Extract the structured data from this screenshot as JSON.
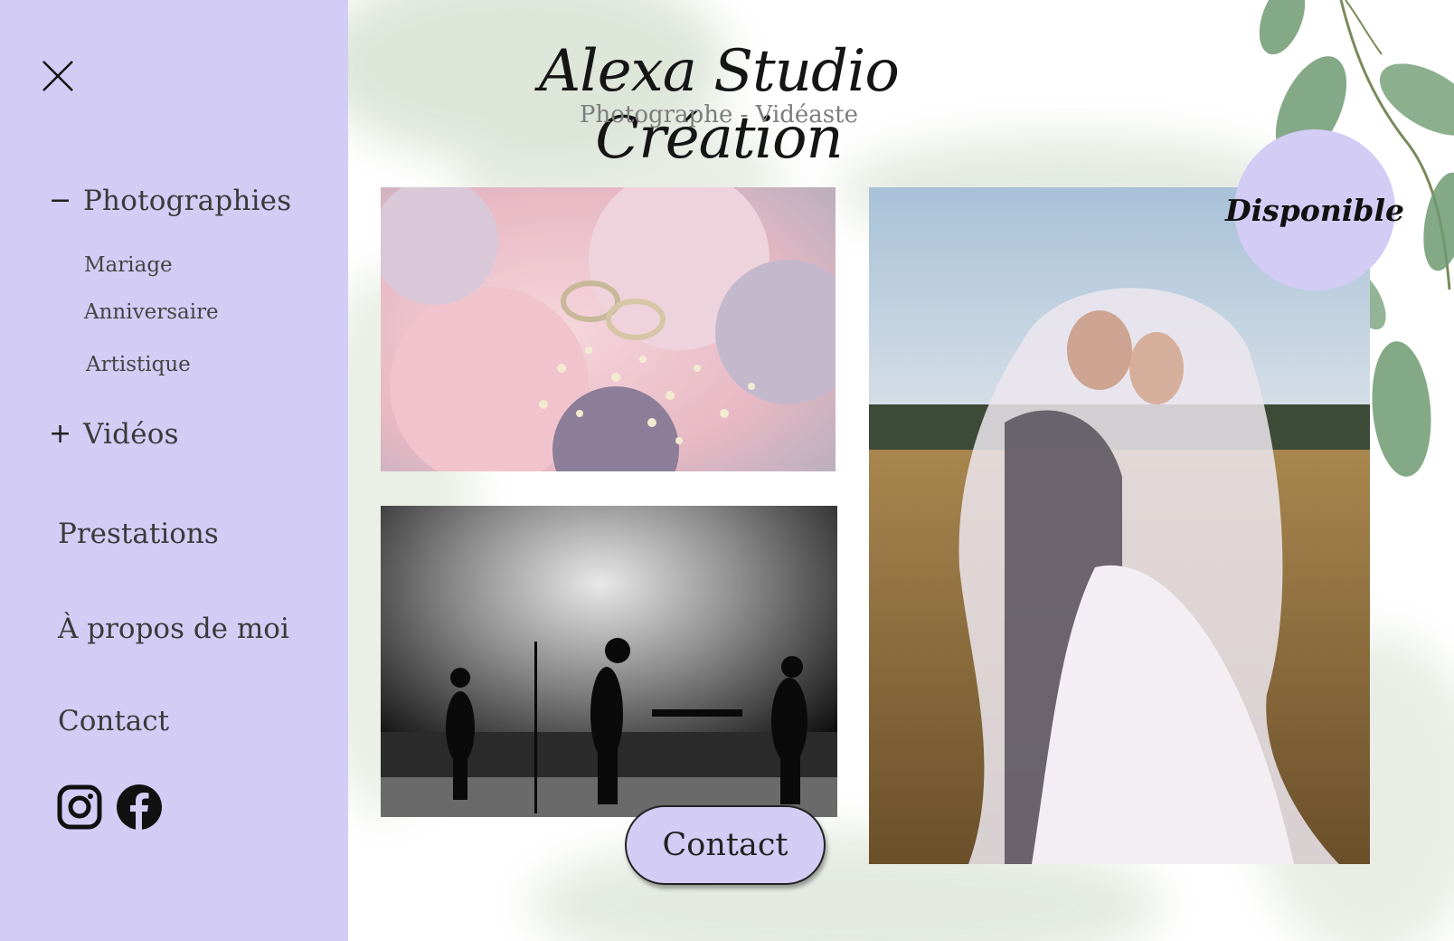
{
  "sidebar": {
    "close_icon": "close-icon",
    "sections": [
      {
        "toggle": "−",
        "label": "Photographies"
      },
      {
        "toggle": "+",
        "label": "Vidéos"
      }
    ],
    "sub_items": [
      "Mariage",
      "Anniversaire",
      "Artistique"
    ],
    "links": [
      "Prestations",
      "À propos de moi",
      "Contact"
    ],
    "socials": [
      "instagram-icon",
      "facebook-icon"
    ]
  },
  "header": {
    "title": "Alexa Studio Création",
    "subtitle": "Photographe - Vidéaste"
  },
  "gallery": {
    "images": [
      "wedding-rings-bouquet",
      "concert-band-silhouette",
      "wedding-couple-veil"
    ]
  },
  "badge": {
    "label": "Disponible"
  },
  "cta": {
    "label": "Contact"
  },
  "colors": {
    "accent": "#d3ccf5",
    "wash": "#d9e2d4",
    "text": "#3a3a3a"
  }
}
